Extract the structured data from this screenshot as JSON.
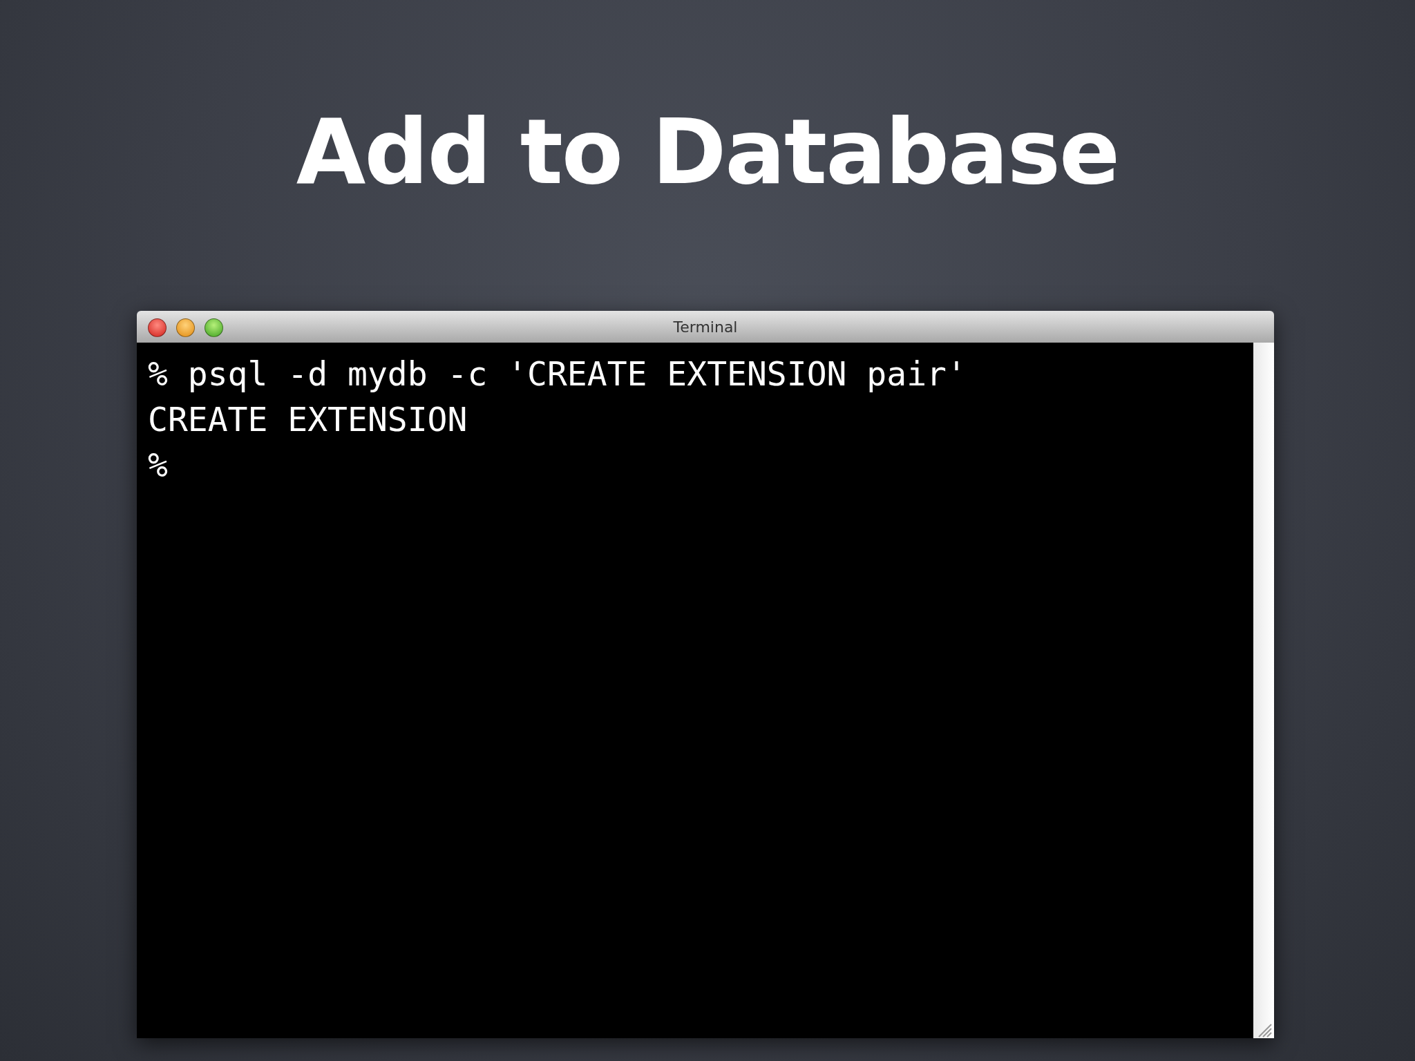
{
  "slide": {
    "title": "Add to Database"
  },
  "window": {
    "title": "Terminal"
  },
  "terminal": {
    "lines": [
      "% psql -d mydb -c 'CREATE EXTENSION pair'",
      "CREATE EXTENSION",
      "%"
    ]
  }
}
